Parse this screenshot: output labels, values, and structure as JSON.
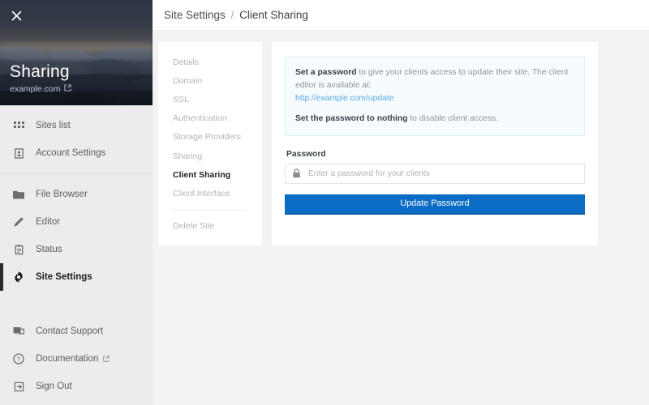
{
  "sidebar": {
    "close_icon": "close-icon",
    "site_title": "Sharing",
    "site_domain": "example.com",
    "domain_external_icon": "external-link-icon",
    "groups": [
      {
        "items": [
          {
            "label": "Sites list",
            "icon": "grid-icon",
            "active": false,
            "external": false
          },
          {
            "label": "Account Settings",
            "icon": "user-card-icon",
            "active": false,
            "external": false
          }
        ]
      },
      {
        "items": [
          {
            "label": "File Browser",
            "icon": "folder-icon",
            "active": false,
            "external": false
          },
          {
            "label": "Editor",
            "icon": "pencil-icon",
            "active": false,
            "external": false
          },
          {
            "label": "Status",
            "icon": "clipboard-icon",
            "active": false,
            "external": false
          },
          {
            "label": "Site Settings",
            "icon": "gear-icon",
            "active": true,
            "external": false
          }
        ]
      },
      {
        "items": [
          {
            "label": "Contact Support",
            "icon": "chat-icon",
            "active": false,
            "external": false
          },
          {
            "label": "Documentation",
            "icon": "question-circle-icon",
            "active": false,
            "external": true
          },
          {
            "label": "Sign Out",
            "icon": "sign-out-icon",
            "active": false,
            "external": false
          }
        ]
      }
    ]
  },
  "breadcrumb": {
    "parent": "Site Settings",
    "separator": "/",
    "current": "Client Sharing"
  },
  "subnav": {
    "items": [
      {
        "label": "Details",
        "active": false
      },
      {
        "label": "Domain",
        "active": false
      },
      {
        "label": "SSL",
        "active": false
      },
      {
        "label": "Authentication",
        "active": false
      },
      {
        "label": "Storage Providers",
        "active": false
      },
      {
        "label": "Sharing",
        "active": false
      },
      {
        "label": "Client Sharing",
        "active": true
      },
      {
        "label": "Client Interface",
        "active": false
      }
    ],
    "danger_item": {
      "label": "Delete Site"
    }
  },
  "panel": {
    "notice": {
      "line1_bold": "Set a password",
      "line1_rest": " to give your clients access to update their site. The client editor is available at:",
      "link": "http://example.com/update",
      "line2_bold": "Set the password to nothing",
      "line2_rest": " to disable client access."
    },
    "password_label": "Password",
    "password_value": "",
    "password_placeholder": "Enter a password for your clients",
    "lock_icon": "lock-icon",
    "submit_label": "Update Password"
  },
  "colors": {
    "accent_blue": "#0a6cc4",
    "link_blue": "#5aa9e2",
    "sidebar_bg": "#ececec",
    "page_bg": "#f3f3f3",
    "active_bar": "#2a2a2a"
  }
}
